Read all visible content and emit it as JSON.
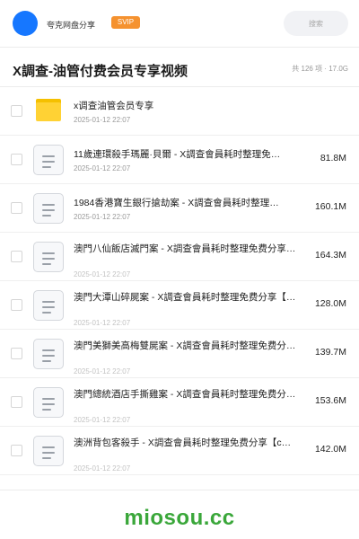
{
  "header": {
    "app_name": "夸克网盘分享",
    "badge": "SVIP",
    "search_placeholder": "搜索"
  },
  "title": "X調查-油管付费会员专享视频",
  "summary": "共 126 项 · 17.0G",
  "colors": {
    "accent": "#1677ff",
    "svip": "#f5922f",
    "folder": "#ffd234",
    "brand": "#3aa73a"
  },
  "files": [
    {
      "type": "folder",
      "icon": "folder-icon",
      "name": "x调查油管会员专享",
      "date": "2025-01-12 22:07",
      "size": ""
    },
    {
      "type": "file",
      "icon": "document-icon",
      "name": "11歲連環殺手瑪麗·貝爾 - X調查會員耗时整理免…",
      "date": "2025-01-12 22:07",
      "size": "81.8M"
    },
    {
      "type": "file",
      "icon": "document-icon",
      "name": "1984香港寶生銀行搶劫案 - X調查會員耗时整理…",
      "date": "2025-01-12 22:07",
      "size": "160.1M"
    },
    {
      "type": "file",
      "icon": "document-icon",
      "name": "澳門八仙飯店滅門案 - X調查會員耗时整理免费分享…",
      "date": "2025-01-12 22:07",
      "size": "164.3M"
    },
    {
      "type": "file",
      "icon": "document-icon",
      "name": "澳門大潭山碎屍案 - X調查會員耗时整理免费分享【…",
      "date": "2025-01-12 22:07",
      "size": "128.0M"
    },
    {
      "type": "file",
      "icon": "document-icon",
      "name": "澳門美獅美高梅雙屍案 - X調查會員耗时整理免费分…",
      "date": "2025-01-12 22:07",
      "size": "139.7M"
    },
    {
      "type": "file",
      "icon": "document-icon",
      "name": "澳門總統酒店手撕雞案 - X調查會員耗时整理免费分…",
      "date": "2025-01-12 22:07",
      "size": "153.6M"
    },
    {
      "type": "file",
      "icon": "document-icon",
      "name": "澳洲背包客殺手 - X調查會員耗时整理免费分享【c…",
      "date": "2025-01-12 22:07",
      "size": "142.0M"
    }
  ],
  "footer": {
    "brand": "miosou.cc"
  }
}
